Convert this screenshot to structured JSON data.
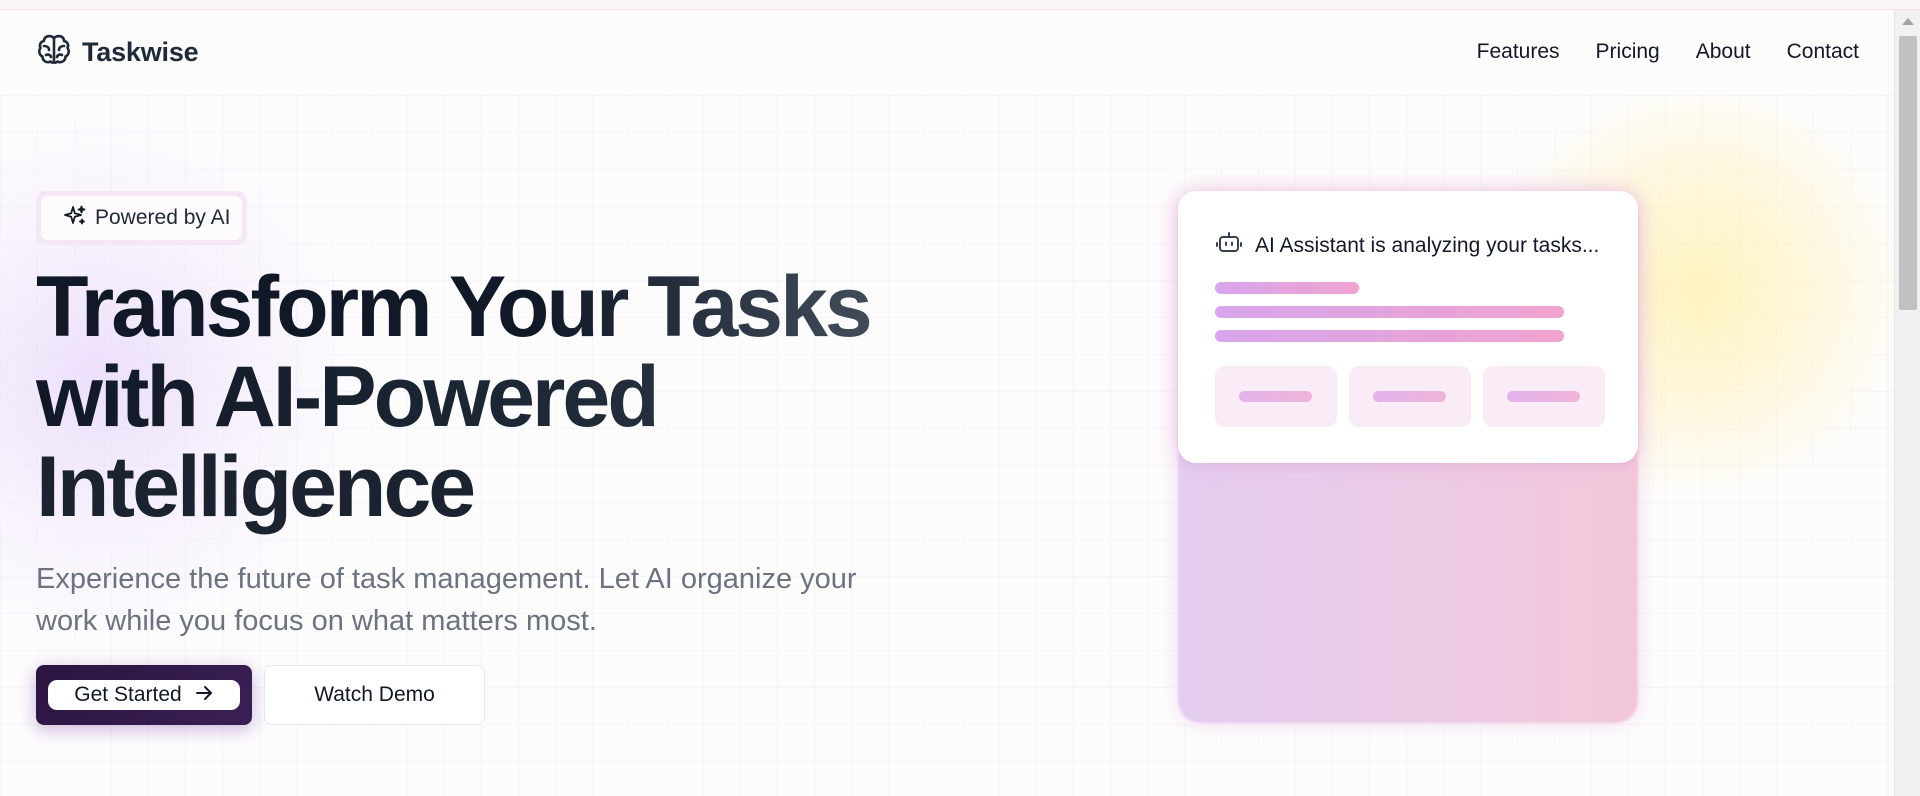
{
  "header": {
    "brand_name": "Taskwise",
    "brand_icon": "brain-icon",
    "nav": [
      "Features",
      "Pricing",
      "About",
      "Contact"
    ]
  },
  "hero": {
    "badge_icon": "sparkles-icon",
    "badge_label": "Powered by AI",
    "headline_lines": [
      "Transform Your Tasks",
      "with AI-Powered",
      "Intelligence"
    ],
    "subtitle_lines": [
      "Experience the future of task management. Let AI organize your",
      "work while you focus on what matters most."
    ],
    "primary_button": {
      "label": "Get Started",
      "icon": "arrow-right-icon"
    },
    "secondary_button": {
      "label": "Watch Demo"
    }
  },
  "ai_card": {
    "icon": "bot-icon",
    "title": "AI Assistant is analyzing your tasks..."
  },
  "colors": {
    "primary_button_bg": "#2b1540",
    "accent_purple": "#d7a6ec",
    "accent_pink": "#f0a3cf",
    "text_muted": "#6b7280"
  }
}
